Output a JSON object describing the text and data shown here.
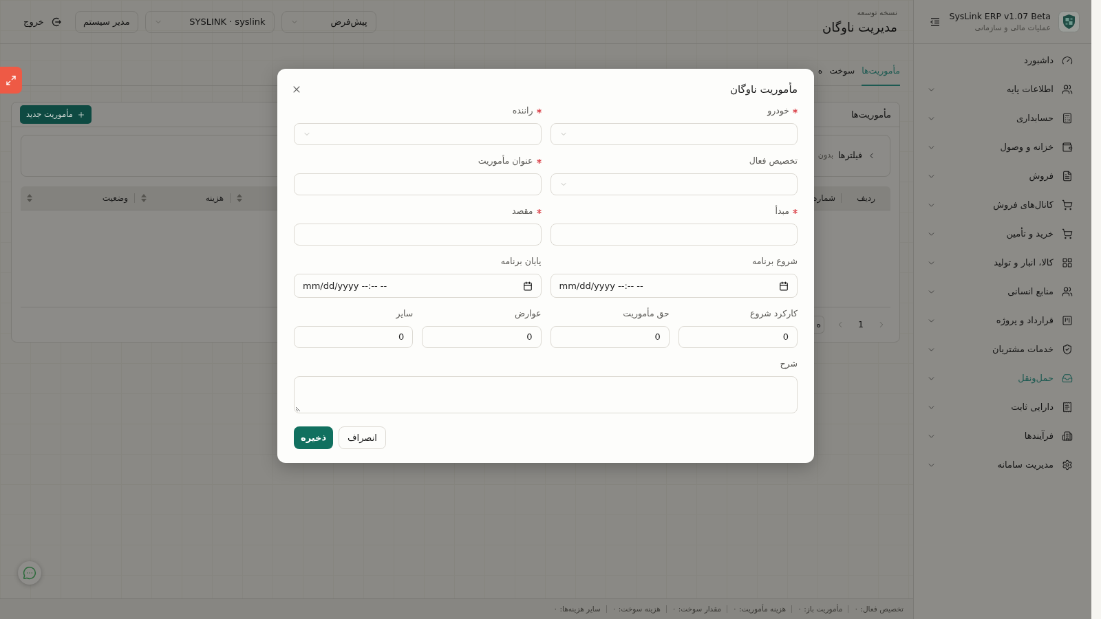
{
  "sidebar": {
    "brand": {
      "title": "SysLink ERP v1.07 Beta",
      "subtitle": "عملیات مالی و سازمانی"
    },
    "items": [
      {
        "label": "داشبورد",
        "kind": "link",
        "selected": false
      },
      {
        "label": "اطلاعات پایه",
        "kind": "group",
        "expanded": false,
        "selected": false
      },
      {
        "label": "حسابداری",
        "kind": "group",
        "expanded": false,
        "selected": false
      },
      {
        "label": "خزانه و وصول",
        "kind": "group",
        "expanded": false,
        "selected": false
      },
      {
        "label": "فروش",
        "kind": "group",
        "expanded": false,
        "selected": false
      },
      {
        "label": "کانال‌های فروش",
        "kind": "group",
        "expanded": false,
        "selected": false
      },
      {
        "label": "خرید و تأمین",
        "kind": "group",
        "expanded": false,
        "selected": false
      },
      {
        "label": "کالا، انبار و تولید",
        "kind": "group",
        "expanded": false,
        "selected": false
      },
      {
        "label": "منابع انسانی",
        "kind": "group",
        "expanded": false,
        "selected": false
      },
      {
        "label": "قرارداد و پروژه",
        "kind": "group",
        "expanded": false,
        "selected": false
      },
      {
        "label": "خدمات مشتریان",
        "kind": "group",
        "expanded": false,
        "selected": false
      },
      {
        "label": "حمل‌ونقل",
        "kind": "group",
        "expanded": false,
        "selected": true
      },
      {
        "label": "دارایی ثابت",
        "kind": "group",
        "expanded": false,
        "selected": false
      },
      {
        "label": "فرآیندها",
        "kind": "group",
        "expanded": false,
        "selected": false
      },
      {
        "label": "مدیریت سامانه",
        "kind": "group",
        "expanded": false,
        "selected": false
      }
    ]
  },
  "header": {
    "subtitle": "نسخه توسعه",
    "title": "مدیریت ناوگان",
    "profile_select": "پیش‌فرض",
    "company_select": "SYSLINK · syslink",
    "user_button": "مدیر سیستم",
    "logout": "خروج"
  },
  "tabs": [
    {
      "label": "مأموریت‌ها",
      "selected": true
    },
    {
      "label": "سوخت",
      "selected": false
    },
    {
      "label": "ه",
      "selected": false
    }
  ],
  "card": {
    "title": "مأموریت‌ها",
    "new_button": "مأموریت جدید",
    "filters": {
      "label": "فیلترها",
      "summary": "بدون",
      "expanded": false
    },
    "table": {
      "columns": [
        {
          "label": "ردیف",
          "sortable": false
        },
        {
          "label": "شماره",
          "sortable": false
        },
        {
          "sortable": true
        },
        {
          "label": "هزینه",
          "sortable": true
        },
        {
          "label": "وضعیت",
          "sortable": true
        }
      ]
    },
    "pagination": {
      "current_page": "1",
      "page_size": "ه"
    }
  },
  "status_bar": [
    "تخصیص فعال: ۰",
    "مأموریت باز: ۰",
    "هزینه مأموریت: ۰",
    "مقدار سوخت: ۰",
    "هزینه سوخت: ۰",
    "سایر هزینه‌ها: ۰"
  ],
  "dialog": {
    "title": "مأموریت ناوگان",
    "rows": [
      [
        {
          "label": "خودرو",
          "required": true,
          "kind": "select"
        },
        {
          "label": "راننده",
          "required": true,
          "kind": "select"
        }
      ],
      [
        {
          "label": "تخصیص فعال",
          "required": false,
          "kind": "select"
        },
        {
          "label": "عنوان مأموریت",
          "required": true,
          "kind": "text"
        }
      ],
      [
        {
          "label": "مبدأ",
          "required": true,
          "kind": "text"
        },
        {
          "label": "مقصد",
          "required": true,
          "kind": "text"
        }
      ],
      [
        {
          "label": "شروع برنامه",
          "required": false,
          "kind": "datetime",
          "placeholder": "mm/dd/yyyy --:-- --"
        },
        {
          "label": "پایان برنامه",
          "required": false,
          "kind": "datetime",
          "placeholder": "mm/dd/yyyy --:-- --"
        }
      ],
      [
        {
          "label": "کارکرد شروع",
          "required": false,
          "kind": "number",
          "value": "0"
        },
        {
          "label": "حق مأموریت",
          "required": false,
          "kind": "number",
          "value": "0"
        },
        {
          "label": "عوارض",
          "required": false,
          "kind": "number",
          "value": "0"
        },
        {
          "label": "سایر",
          "required": false,
          "kind": "number",
          "value": "0"
        }
      ],
      [
        {
          "label": "شرح",
          "required": false,
          "kind": "textarea"
        }
      ]
    ],
    "buttons": [
      {
        "label": "انصراف",
        "kind": "secondary"
      },
      {
        "label": "ذخیره",
        "kind": "primary"
      }
    ]
  }
}
